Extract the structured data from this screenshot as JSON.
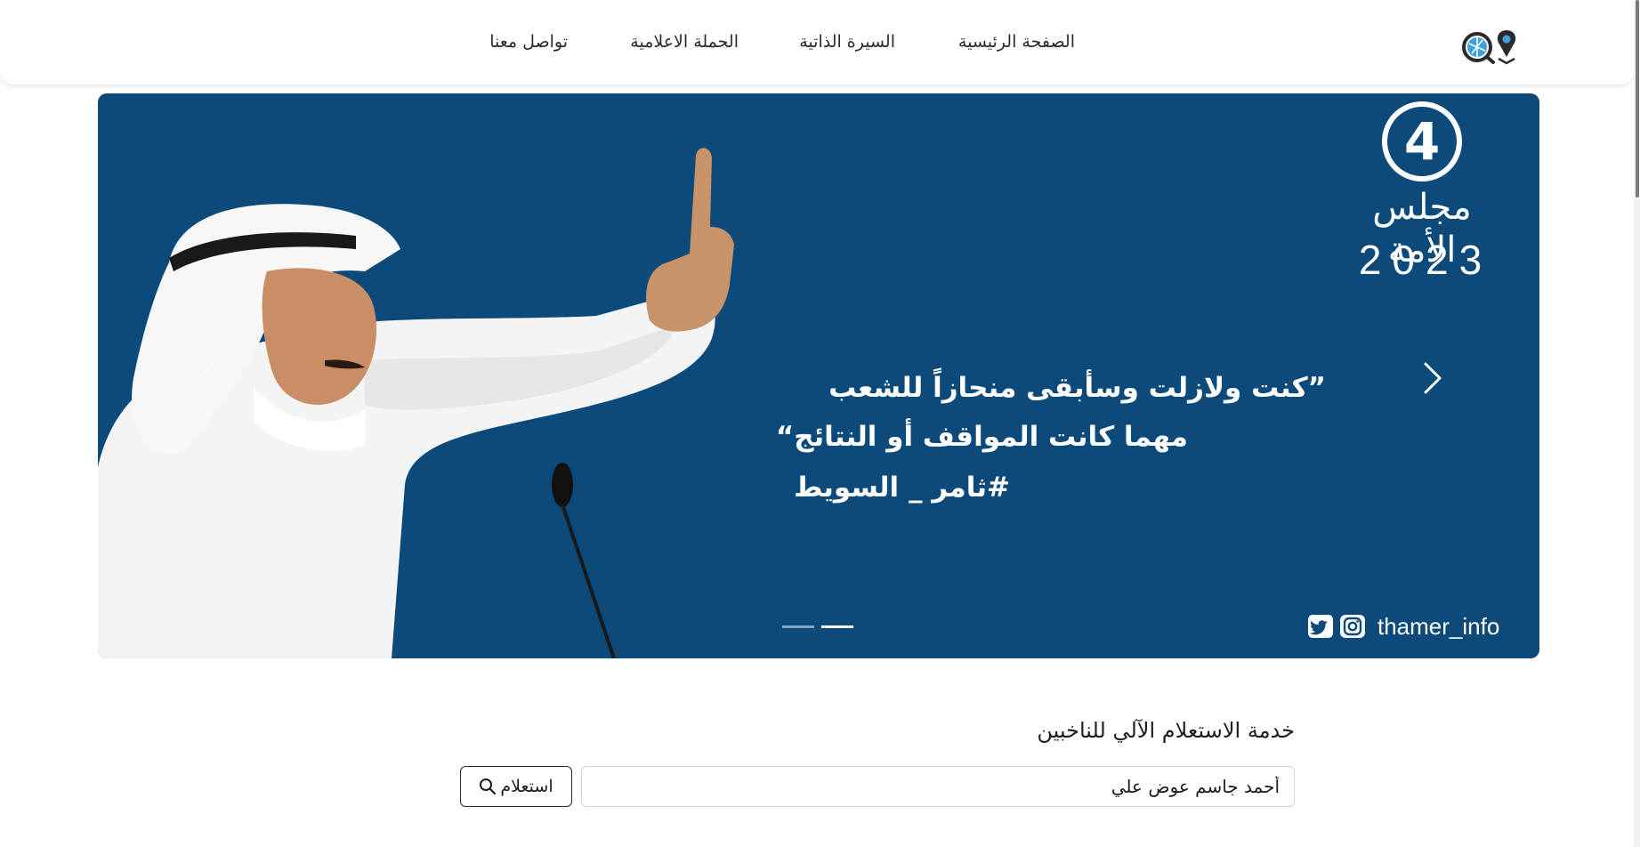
{
  "header": {
    "logo": "search-location-logo",
    "nav": [
      {
        "id": "home",
        "label": "الصفحة الرئيسية"
      },
      {
        "id": "biography",
        "label": "السيرة الذاتية"
      },
      {
        "id": "campaign",
        "label": "الحملة الاعلامية"
      },
      {
        "id": "contact",
        "label": "تواصل معنا"
      }
    ]
  },
  "hero": {
    "badge_number": "4",
    "badge_title": "مجلس الأمة",
    "badge_year": "2023",
    "quote_line1": "”كنت ولازلت وسأبقى منحازاً للشعب",
    "quote_line2": "مهما كانت المواقف أو النتائج“",
    "quote_line3": "#ثامر _ السويط",
    "social_handle": "thamer_info",
    "social_icons": [
      "twitter-icon",
      "instagram-icon"
    ],
    "slide_count": 2,
    "active_slide": 2,
    "colors": {
      "background": "#0b4a7a",
      "text": "#ffffff"
    }
  },
  "service": {
    "title": "خدمة الاستعلام الآلي للناخبين",
    "search_value": "أحمد جاسم عوض علي",
    "button_label": "استعلام"
  }
}
